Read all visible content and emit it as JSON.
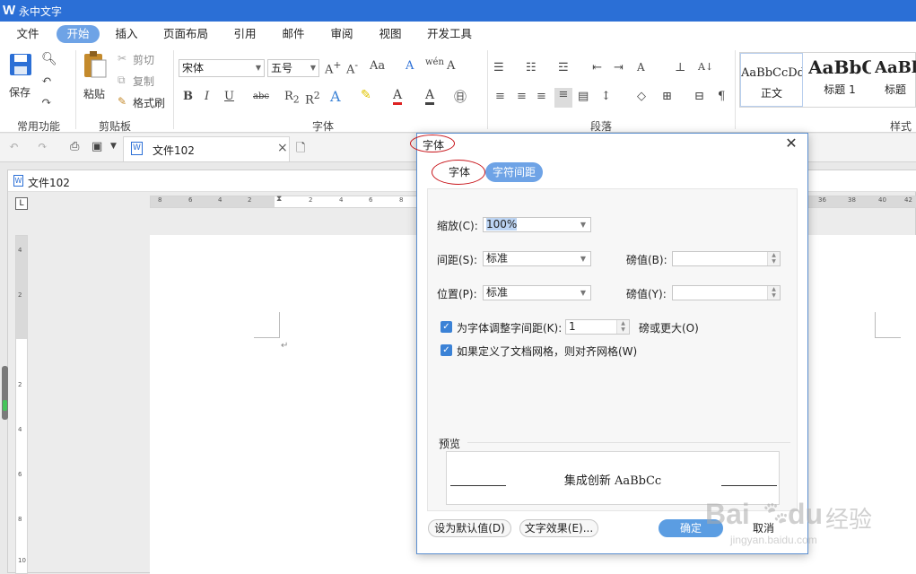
{
  "app": {
    "title": "永中文字",
    "logo_letter": "W"
  },
  "menu": [
    "文件",
    "开始",
    "插入",
    "页面布局",
    "引用",
    "邮件",
    "审阅",
    "视图",
    "开发工具"
  ],
  "ribbon": {
    "groups": [
      "常用功能",
      "剪贴板",
      "字体",
      "段落",
      "样式"
    ],
    "save_label": "保存",
    "paste_label": "粘贴",
    "cut_label": "剪切",
    "copy_label": "复制",
    "format_painter_label": "格式刷",
    "font_name": "宋体",
    "font_size": "五号",
    "styles": [
      {
        "sample": "AaBbCcDd",
        "name": "正文"
      },
      {
        "sample": "AaBbC",
        "name": "标题 1"
      },
      {
        "sample": "AaBl",
        "name": "标题"
      }
    ]
  },
  "doc_tab": {
    "label": "文件102",
    "close": "×"
  },
  "doc_window_title": "文件102",
  "ruler": {
    "h_ticks": [
      "8",
      "6",
      "4",
      "2",
      "2",
      "4",
      "6",
      "8",
      "36",
      "38",
      "40",
      "42"
    ],
    "v_ticks": [
      "4",
      "2",
      "2",
      "4",
      "6",
      "8",
      "10"
    ]
  },
  "dialog": {
    "title": "字体",
    "close": "✕",
    "tabs": [
      "字体",
      "字符间距"
    ],
    "scale_label": "缩放(C):",
    "scale_value": "100%",
    "spacing_label": "间距(S):",
    "spacing_value": "标准",
    "spacing_pt_label": "磅值(B):",
    "spacing_pt_value": "",
    "position_label": "位置(P):",
    "position_value": "标准",
    "position_pt_label": "磅值(Y):",
    "position_pt_value": "",
    "kerning_label": "为字体调整字间距(K):",
    "kerning_value": "1",
    "kerning_suffix": "磅或更大(O)",
    "grid_label": "如果定义了文档网格，则对齐网格(W)",
    "preview_label": "预览",
    "preview_text": "集成创新 AaBbCc",
    "buttons": {
      "default": "设为默认值(D)",
      "effects": "文字效果(E)...",
      "ok": "确定",
      "cancel": "取消"
    }
  },
  "watermark": {
    "brand": "Bai",
    "brand2": "du",
    "cn": "经验",
    "url": "jingyan.baidu.com"
  },
  "colors": {
    "accent": "#2b6fd6",
    "tab_active": "#6ea3e6",
    "annotation": "#c8141a",
    "checkbox": "#3b82d6"
  }
}
